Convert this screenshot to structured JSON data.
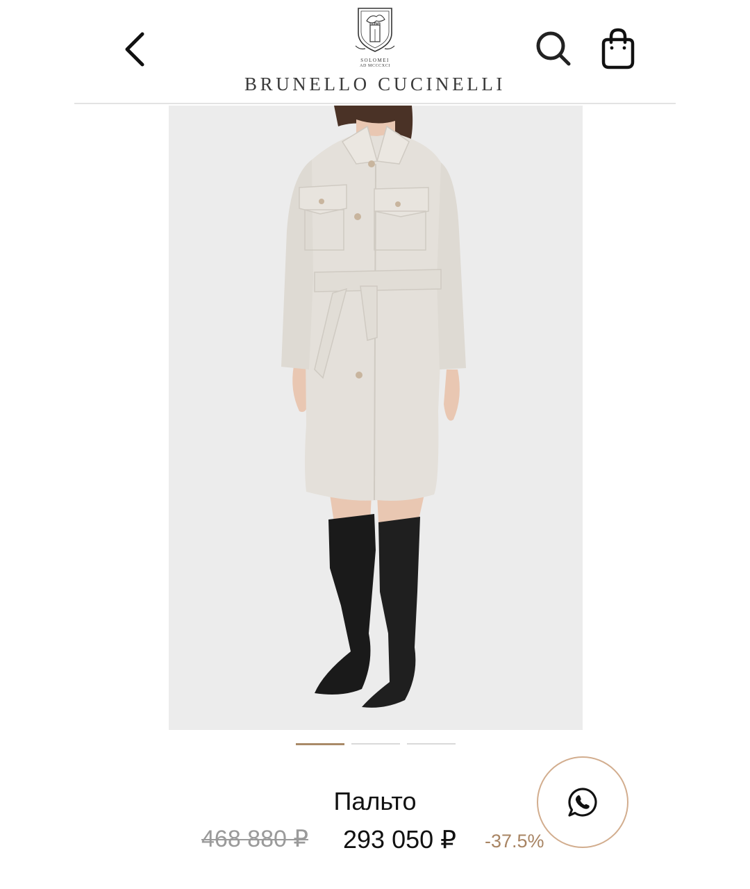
{
  "header": {
    "back_icon": "chevron-left-icon",
    "logo": {
      "emblem_line1": "SOLOMEI",
      "emblem_line2": "AD MCCCXCI",
      "brand_name": "BRUNELLO CUCINELLI"
    },
    "search_icon": "search-icon",
    "cart_icon": "shopping-bag-icon"
  },
  "product": {
    "image_alt": "coat-photo",
    "colors": {
      "background": "#ececec",
      "coat": "#e4e0da",
      "boots": "#1a1a1a",
      "skin": "#e9c7b2",
      "hair": "#4a3226"
    },
    "carousel": {
      "total": 3,
      "active_index": 0
    },
    "name": "Пальто",
    "old_price": "468 880 ₽",
    "price": "293 050 ₽",
    "discount": "-37.5%"
  },
  "whatsapp": {
    "icon": "whatsapp-icon"
  },
  "theme": {
    "accent": "#a98a68",
    "divider": "#e3e3e3",
    "text": "#111111",
    "muted": "#9a9a9a"
  }
}
